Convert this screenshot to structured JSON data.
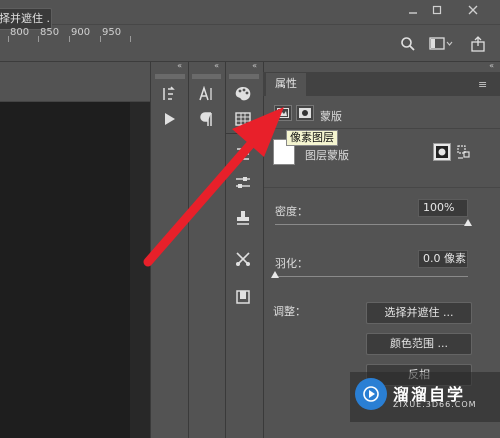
{
  "options_bar": {
    "select_and_mask_label": "择并遮住 ..."
  },
  "ruler": {
    "ticks": [
      "800",
      "850",
      "900",
      "950"
    ]
  },
  "panel_collapse": {
    "glyph": "«"
  },
  "properties": {
    "tab_label": "属性",
    "menu_glyph": "≡",
    "mask_label": "蒙版",
    "tooltip": "像素图层",
    "layer_mask_label": "图层蒙版",
    "density_label": "密度：",
    "density_value": "100%",
    "density_fraction": 1.0,
    "feather_label": "羽化：",
    "feather_value": "0.0 像素",
    "feather_fraction": 0.0,
    "adjust_label": "调整：",
    "buttons": {
      "select_mask": "选择并遮住 ...",
      "color_range": "颜色范围 ...",
      "invert": "反相"
    }
  },
  "watermark": {
    "name": "溜溜自学",
    "url": "ZIXUE.3D66.COM"
  },
  "colors": {
    "arrow": "#e8202a",
    "panel_bg": "#535353",
    "canvas_bg": "#282828"
  }
}
